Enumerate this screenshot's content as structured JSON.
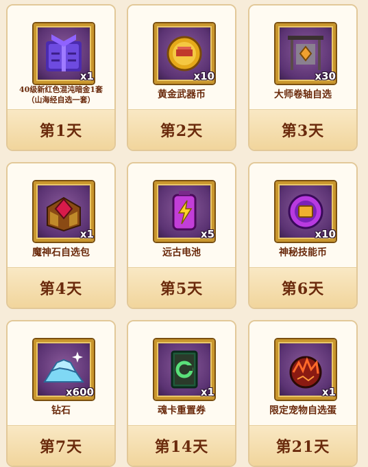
{
  "rewards": [
    {
      "name": "40级新红色混沌暗金1套",
      "sub": "（山海经自选一套）",
      "qty": "x1",
      "day": "第1天",
      "icon": "chaos-armor-set-icon"
    },
    {
      "name": "黄金武器币",
      "qty": "x10",
      "day": "第2天",
      "icon": "gold-weapon-coin-icon"
    },
    {
      "name": "大师卷轴自选",
      "qty": "x30",
      "day": "第3天",
      "icon": "master-scroll-icon"
    },
    {
      "name": "魔神石自选包",
      "qty": "x1",
      "day": "第4天",
      "icon": "demon-stone-pack-icon"
    },
    {
      "name": "远古电池",
      "qty": "x5",
      "day": "第5天",
      "icon": "ancient-battery-icon"
    },
    {
      "name": "神秘技能币",
      "qty": "x10",
      "day": "第6天",
      "icon": "mystic-skill-coin-icon"
    },
    {
      "name": "钻石",
      "qty": "x600",
      "day": "第7天",
      "icon": "diamond-pile-icon"
    },
    {
      "name": "魂卡重置券",
      "qty": "x1",
      "day": "第14天",
      "icon": "soul-card-reset-ticket-icon"
    },
    {
      "name": "限定宠物自选蛋",
      "qty": "x1",
      "day": "第21天",
      "icon": "limited-pet-egg-icon"
    }
  ],
  "colors": {
    "card_text": "#6a2a0c",
    "frame_gold": "#c9962d",
    "icon_bg": "#5b3373"
  }
}
